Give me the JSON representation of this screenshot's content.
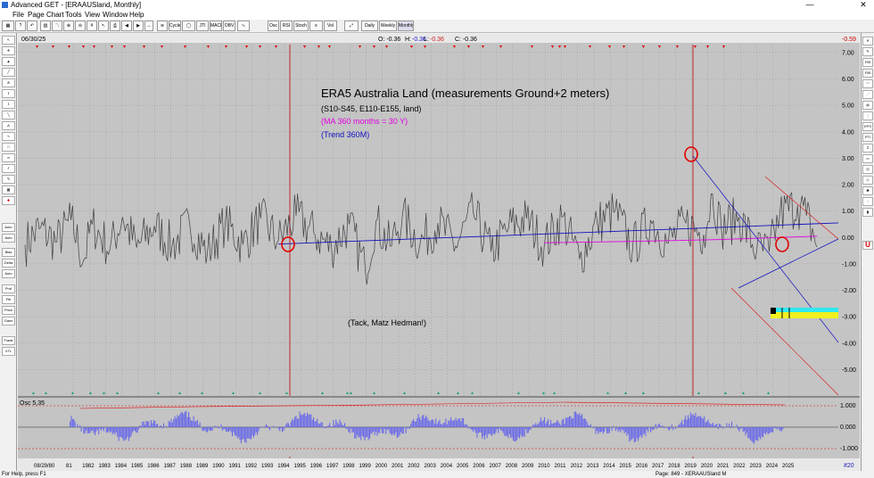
{
  "window": {
    "title": "Advanced GET - [ERAAUSland, Monthly]",
    "minimize": "—",
    "close": "✕"
  },
  "menu": [
    "File",
    "Page",
    "Chart",
    "Tools",
    "View",
    "Window",
    "Help"
  ],
  "toolbar": [
    "Osc",
    "RSI",
    "Stoch",
    "Vol",
    "Daily",
    "Weekly",
    "Monthly",
    "Cycles",
    "JTI",
    "MACD",
    "OBV"
  ],
  "left_tools": [
    "Auto Gann",
    "Auto Trend",
    "Bias",
    "Delta",
    "Auto Fib",
    "Prof",
    "Fib Time",
    "Price Chart",
    "Gann Fan",
    "Trade Profile",
    "XTL"
  ],
  "right_tools": [
    "FIB",
    "FIB EXT",
    "EPS",
    "PTI",
    "U"
  ],
  "header": {
    "date": "06/30/25",
    "open": "O: -0.36",
    "high_label": "H:",
    "high": "-0.36",
    "low_label": "L:",
    "low": "-0.36",
    "close": "C: -0.36",
    "last_value": "-0.59"
  },
  "annotations": {
    "title": "ERA5 Australia Land (measurements Ground+2 meters)",
    "region": "(S10-S45, E110-E155, land)",
    "ma": "(MA 360 months = 30 Y)",
    "trend": "(Trend 360M)",
    "thanks": "(Tack, Matz Hedman!)"
  },
  "colors": {
    "ma_line": "#e000e0",
    "trend_line": "#1010c0",
    "price_line": "#404040",
    "osc_bar": "#6a6ae8",
    "marker": "#e00000",
    "panel_bg": "#c4c4c4"
  },
  "osc": {
    "label": "Osc 5,35",
    "upper": "1.000",
    "zero": "0.000",
    "lower": "-1.000"
  },
  "footer": {
    "corner": "#20",
    "first_date": "08/29/80"
  },
  "status": {
    "help": "For Help, press F1",
    "page": "Page: 849 - XERAAUSland M"
  },
  "chart_data": {
    "type": "line",
    "title": "ERA5 Australia Land (measurements Ground+2 meters)",
    "x_ticks": [
      "81",
      "1982",
      "1983",
      "1984",
      "1985",
      "1986",
      "1987",
      "1988",
      "1989",
      "1990",
      "1991",
      "1992",
      "1993",
      "1994",
      "1995",
      "1996",
      "1997",
      "1998",
      "1999",
      "2000",
      "2001",
      "2002",
      "2003",
      "2004",
      "2005",
      "2006",
      "2007",
      "2008",
      "2009",
      "2010",
      "2011",
      "2012",
      "2013",
      "2014",
      "2015",
      "2016",
      "2017",
      "2018",
      "2019",
      "2020",
      "2021",
      "2022",
      "2023",
      "2024",
      "2025"
    ],
    "y_ticks": [
      "7.00",
      "6.00",
      "5.00",
      "4.00",
      "3.00",
      "2.00",
      "1.00",
      "0.00",
      "-1.00",
      "-2.00",
      "-3.00",
      "-4.00",
      "-5.00"
    ],
    "y_values": [
      7,
      6,
      5,
      4,
      3,
      2,
      1,
      0,
      -1,
      -2,
      -3,
      -4,
      -5
    ],
    "ylim": [
      -6.0,
      7.3
    ],
    "xlim": [
      1980.6,
      2026.6
    ],
    "series": [
      {
        "values": [
          [
            1980.7,
            -0.5
          ],
          [
            1981.5,
            0.6
          ],
          [
            1982.5,
            -0.3
          ],
          [
            1983.3,
            1.2
          ],
          [
            1984.0,
            -1.6
          ],
          [
            1984.5,
            0.9
          ],
          [
            1985.5,
            -0.8
          ],
          [
            1986.2,
            1.4
          ],
          [
            1987.0,
            -0.7
          ],
          [
            1988.0,
            0.8
          ],
          [
            1989.0,
            -0.6
          ],
          [
            1990.0,
            0.9
          ],
          [
            1991.0,
            -1.1
          ],
          [
            1992.0,
            1.0
          ],
          [
            1993.0,
            -0.5
          ],
          [
            1994.0,
            1.3
          ],
          [
            1995.0,
            -0.2
          ],
          [
            1996.0,
            1.5
          ],
          [
            1997.0,
            0.3
          ],
          [
            1998.0,
            -0.7
          ],
          [
            1999.0,
            0.9
          ],
          [
            1999.9,
            -2.2
          ],
          [
            2000.5,
            1.1
          ],
          [
            2001.3,
            -0.6
          ],
          [
            2002.0,
            1.5
          ],
          [
            2003.0,
            -0.4
          ],
          [
            2004.0,
            1.0
          ],
          [
            2005.0,
            -0.6
          ],
          [
            2006.0,
            1.7
          ],
          [
            2007.0,
            -1.0
          ],
          [
            2008.0,
            0.7
          ],
          [
            2009.0,
            1.3
          ],
          [
            2010.0,
            -0.6
          ],
          [
            2011.0,
            1.4
          ],
          [
            2012.0,
            -1.5
          ],
          [
            2013.0,
            1.0
          ],
          [
            2014.0,
            1.8
          ],
          [
            2015.0,
            -0.7
          ],
          [
            2016.0,
            1.2
          ],
          [
            2017.0,
            -0.4
          ],
          [
            2018.0,
            1.0
          ],
          [
            2019.0,
            0.2
          ],
          [
            2019.5,
            3.0
          ],
          [
            2020.0,
            0.6
          ],
          [
            2021.0,
            1.4
          ],
          [
            2022.0,
            -0.9
          ],
          [
            2022.7,
            -1.0
          ],
          [
            2023.3,
            1.6
          ],
          [
            2024.3,
            2.2
          ],
          [
            2024.8,
            1.5
          ],
          [
            2025.4,
            -0.36
          ]
        ]
      },
      {
        "name": "MA 360 months",
        "values": [
          [
            2010.0,
            -0.2
          ],
          [
            2015.0,
            -0.15
          ],
          [
            2020.0,
            -0.08
          ],
          [
            2025.4,
            0.05
          ]
        ]
      },
      {
        "name": "Trend 360M",
        "values": [
          [
            1995.0,
            -0.25
          ],
          [
            2026.6,
            0.55
          ]
        ]
      }
    ]
  }
}
